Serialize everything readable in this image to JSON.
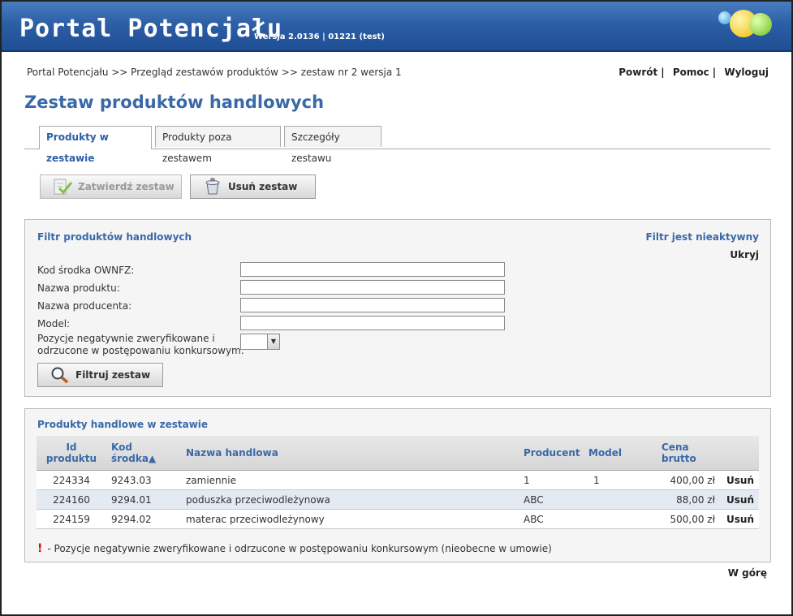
{
  "header": {
    "title": "Portal Potencjału",
    "version": "Wersja 2.0136 | 01221 (test)"
  },
  "breadcrumb": "Portal Potencjału >> Przegląd zestawów produktów >> zestaw nr 2 wersja 1",
  "top_links": {
    "back": "Powrót",
    "help": "Pomoc",
    "logout": "Wyloguj"
  },
  "page_title": "Zestaw produktów handlowych",
  "tabs": [
    {
      "label": "Produkty w zestawie",
      "active": true
    },
    {
      "label": "Produkty poza zestawem",
      "active": false
    },
    {
      "label": "Szczegóły zestawu",
      "active": false
    }
  ],
  "actions": {
    "approve_label": "Zatwierdź zestaw",
    "delete_label": "Usuń zestaw"
  },
  "filter": {
    "title": "Filtr produktów handlowych",
    "status": "Filtr jest nieaktywny",
    "hide_label": "Ukryj",
    "fields": {
      "code_label": "Kod środka OWNFZ:",
      "code_value": "",
      "name_label": "Nazwa produktu:",
      "name_value": "",
      "producer_label": "Nazwa producenta:",
      "producer_value": "",
      "model_label": "Model:",
      "model_value": "",
      "negative_label_1": "Pozycje negatywnie zweryfikowane i",
      "negative_label_2": "odrzucone w postępowaniu konkursowym:",
      "negative_value": ""
    },
    "filter_button": "Filtruj zestaw"
  },
  "products": {
    "title": "Produkty handlowe w zestawie",
    "columns": {
      "id_1": "Id",
      "id_2": "produktu",
      "code_1": "Kod",
      "code_2": "środka▲",
      "name": "Nazwa handlowa",
      "producer": "Producent",
      "model": "Model",
      "price_1": "Cena",
      "price_2": "brutto"
    },
    "rows": [
      {
        "id": "224334",
        "code": "9243.03",
        "name": "zamiennie",
        "producer": "1",
        "model": "1",
        "price": "400,00 zł",
        "action": "Usuń"
      },
      {
        "id": "224160",
        "code": "9294.01",
        "name": "poduszka przeciwodleżynowa",
        "producer": "ABC",
        "model": "",
        "price": "88,00 zł",
        "action": "Usuń"
      },
      {
        "id": "224159",
        "code": "9294.02",
        "name": "materac przeciwodleżynowy",
        "producer": "ABC",
        "model": "",
        "price": "500,00 zł",
        "action": "Usuń"
      }
    ],
    "legend_mark": "!",
    "legend_text": "- Pozycje negatywnie zweryfikowane i odrzucone w postępowaniu konkursowym (nieobecne w umowie)"
  },
  "footer": {
    "up_link": "W górę"
  }
}
